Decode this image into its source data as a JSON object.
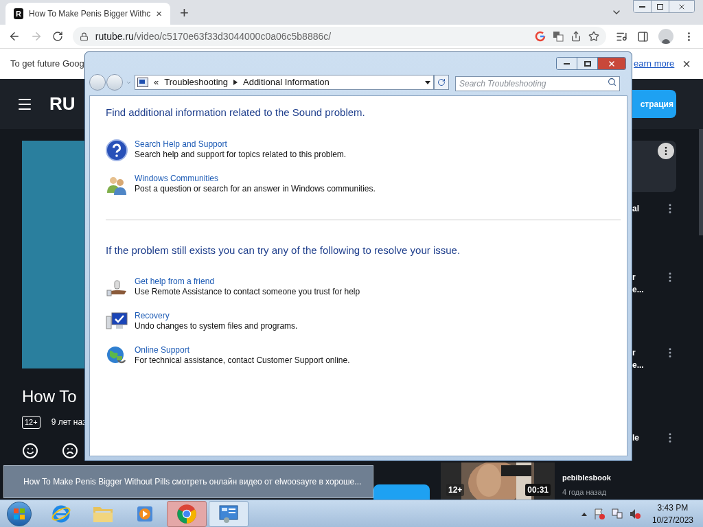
{
  "browser": {
    "tab": {
      "favicon": "R",
      "title": "How To Make Penis Bigger Withc",
      "close": "×",
      "selected": true
    },
    "new_tab": "+",
    "url_host": "rutube.ru",
    "url_path": "/video/c5170e63f33d3044000c0a06c5b8886c/"
  },
  "infobar": {
    "message": "To get future Goog",
    "link": "earn more",
    "close": "×"
  },
  "page": {
    "logo": "RU",
    "register_button": "страция",
    "video_title": "How To",
    "age_badge": "12+",
    "date": "9 лет наз",
    "side_items": [
      {
        "lines": [
          "al"
        ]
      },
      {
        "lines": [
          "r",
          "e..."
        ]
      },
      {
        "lines": [
          "r",
          "e..."
        ]
      },
      {
        "lines": [
          "le"
        ]
      }
    ],
    "bottom_video": {
      "age_badge": "12+",
      "duration": "00:31",
      "channel": "pebiblesbook",
      "date": "4 года назад"
    }
  },
  "dialog": {
    "overflow": "«",
    "breadcrumb": [
      "Troubleshooting",
      "Additional Information"
    ],
    "search_placeholder": "Search Troubleshooting",
    "sections": [
      {
        "heading": "Find additional information related to the Sound problem.",
        "items": [
          {
            "kind": "help",
            "title": "Search Help and Support",
            "description": "Search help and support for topics related to this problem."
          },
          {
            "kind": "community",
            "title": "Windows Communities",
            "description": "Post a question or search for an answer in Windows communities."
          }
        ]
      },
      {
        "heading": "If the problem still exists you can try any of the following to resolve your issue.",
        "items": [
          {
            "kind": "friend",
            "title": "Get help from a friend",
            "description": "Use Remote Assistance to contact someone you trust for help"
          },
          {
            "kind": "recovery",
            "title": "Recovery",
            "description": "Undo changes to system files and programs."
          },
          {
            "kind": "online",
            "title": "Online Support",
            "description": "For technical assistance, contact Customer Support online."
          }
        ]
      }
    ]
  },
  "taskbar_preview": {
    "title": "How To Make Penis Bigger Without Pills смотреть онлайн видео от elwoosayre в хороше..."
  },
  "taskbar": {
    "apps": [
      {
        "kind": "ie",
        "selected": false
      },
      {
        "kind": "explorer",
        "selected": false
      },
      {
        "kind": "media",
        "selected": false
      },
      {
        "kind": "chrome",
        "selected": true
      },
      {
        "kind": "troubleshoot",
        "selected": false
      }
    ],
    "clock": {
      "time": "3:43 PM",
      "date": "10/27/2023"
    }
  }
}
